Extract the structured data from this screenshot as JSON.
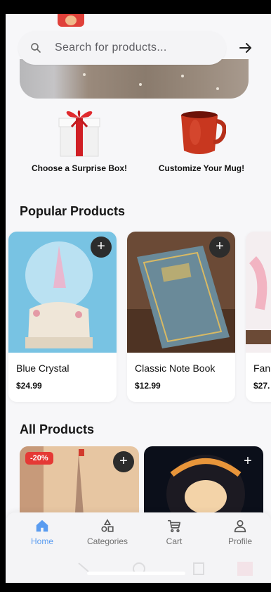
{
  "search": {
    "placeholder": "Search for products...",
    "arrow_icon": "arrow-right-icon",
    "search_icon": "search-icon"
  },
  "features": [
    {
      "label": "Choose a Surprise Box!",
      "icon": "gift-box-icon"
    },
    {
      "label": "Customize Your Mug!",
      "icon": "mug-icon"
    }
  ],
  "sections": {
    "popular_title": "Popular Products",
    "all_title": "All Products"
  },
  "popular_products": [
    {
      "name": "Blue Crystal",
      "price": "$24.99"
    },
    {
      "name": "Classic Note Book",
      "price": "$12.99"
    },
    {
      "name": "Fan",
      "price": "$27."
    }
  ],
  "all_products": [
    {
      "badge": "-20%"
    },
    {
      "badge": ""
    }
  ],
  "nav": {
    "items": [
      {
        "label": "Home",
        "icon": "home-icon",
        "active": true
      },
      {
        "label": "Categories",
        "icon": "categories-icon",
        "active": false
      },
      {
        "label": "Cart",
        "icon": "cart-icon",
        "active": false
      },
      {
        "label": "Profile",
        "icon": "profile-icon",
        "active": false
      }
    ]
  },
  "colors": {
    "accent": "#5a9cf0",
    "badge": "#e53935",
    "plus_button": "#2c2c2c"
  }
}
